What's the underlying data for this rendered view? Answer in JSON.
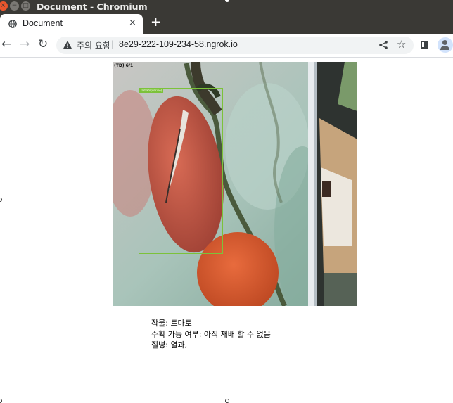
{
  "window": {
    "title": "Document - Chromium",
    "buttons": {
      "close": "×",
      "minimize": "−",
      "maximize": "□"
    }
  },
  "tab": {
    "title": "Document",
    "close_glyph": "×",
    "new_tab_glyph": "+"
  },
  "toolbar": {
    "back_glyph": "←",
    "forward_glyph": "→",
    "reload_glyph": "↻",
    "security_label": "주의 요함",
    "separator": "|",
    "url": "8e29-222-109-234-58.ngrok.io",
    "bookmark_glyph": "☆"
  },
  "image": {
    "corner_label": "(TD) 6/1",
    "detection_label": "tomato(unripe)"
  },
  "result": {
    "crop": "작물: 토마토",
    "harvest": "수확 가능 여부: 아직 재배 할 수 없음",
    "disease": "질병: 열과,"
  },
  "colors": {
    "titlebar": "#3a3935",
    "close_button": "#e9562d",
    "bounding_box": "#7cc23a",
    "omnibox": "#f1f3f4"
  }
}
